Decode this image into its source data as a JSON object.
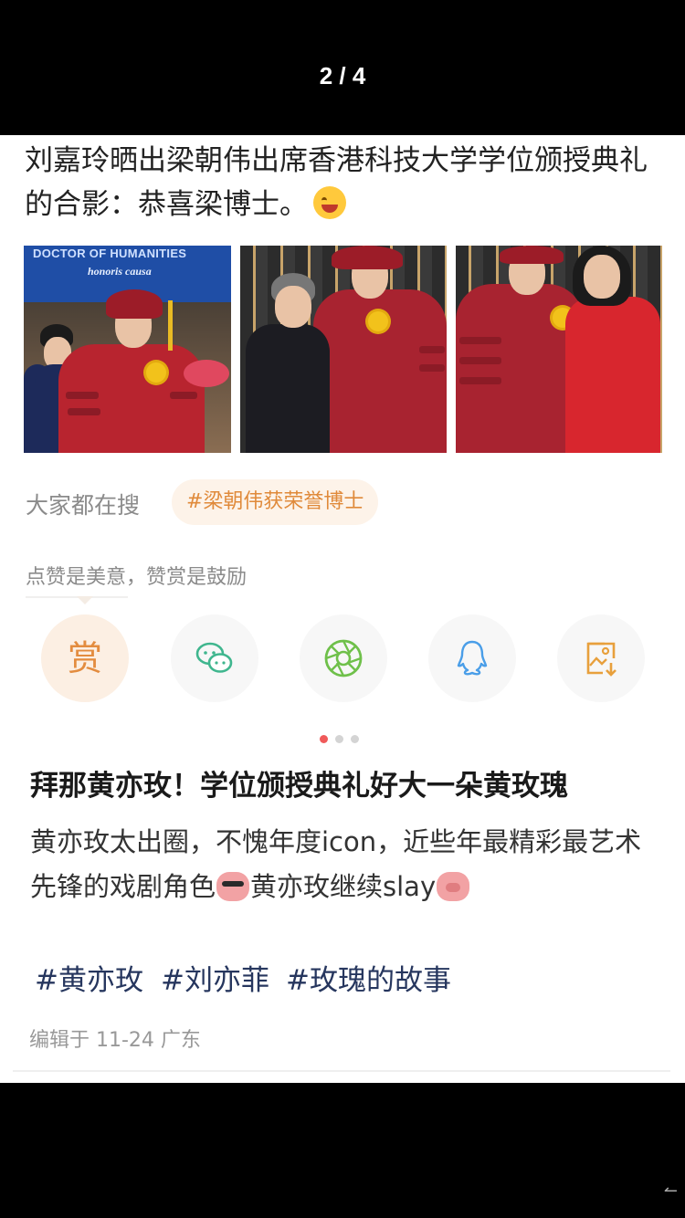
{
  "viewer": {
    "page_counter": "2 / 4"
  },
  "post": {
    "text": "刘嘉玲晒出梁朝伟出席香港科技大学学位颁授典礼的合影：恭喜梁博士。",
    "emoji": "laugh-emoji",
    "photos": {
      "banner_title": "DOCTOR OF HUMANITIES",
      "banner_subtitle": "honoris causa"
    }
  },
  "trending": {
    "label": "大家都在搜",
    "hashtag": "#梁朝伟获荣誉博士"
  },
  "reward": {
    "hint": "点赞是美意，赞赏是鼓励",
    "reward_glyph": "赏",
    "share_buttons": [
      "reward",
      "wechat",
      "moments",
      "qq",
      "save-image"
    ],
    "accent_color": "#e38c3f"
  },
  "pager": {
    "active_index": 0,
    "count": 3
  },
  "article": {
    "title": "拜那黄亦玫！学位颁授典礼好大一朵黄玫瑰",
    "body_part1": "黄亦玫太出圈，不愧年度icon，近些年最精彩最艺术先锋的戏剧角色",
    "body_part2": "黄亦玫继续slay",
    "tags": [
      "#黄亦玫",
      "#刘亦菲",
      "#玫瑰的故事"
    ],
    "tag_color": "#26365e",
    "edit_info": "编辑于 11-24 广东"
  }
}
